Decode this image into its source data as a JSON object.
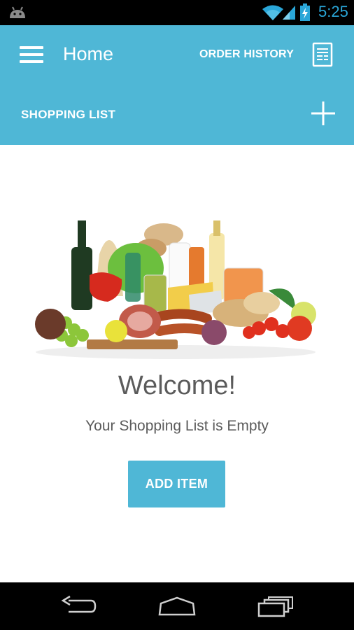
{
  "status_bar": {
    "time": "5:25",
    "icons": [
      "android-icon",
      "wifi-icon",
      "signal-icon",
      "battery-icon"
    ],
    "accent": "#2aa6d8"
  },
  "app_bar": {
    "title": "Home",
    "order_history_label": "ORDER HISTORY",
    "section_title": "SHOPPING LIST",
    "color": "#4fb7d6",
    "icons": [
      "menu-icon",
      "receipt-icon",
      "add-icon"
    ]
  },
  "main": {
    "welcome": "Welcome!",
    "empty_message": "Your Shopping List is Empty",
    "add_item_label": "ADD ITEM"
  },
  "nav_bar": {
    "icons": [
      "back-icon",
      "home-icon",
      "recents-icon"
    ]
  }
}
